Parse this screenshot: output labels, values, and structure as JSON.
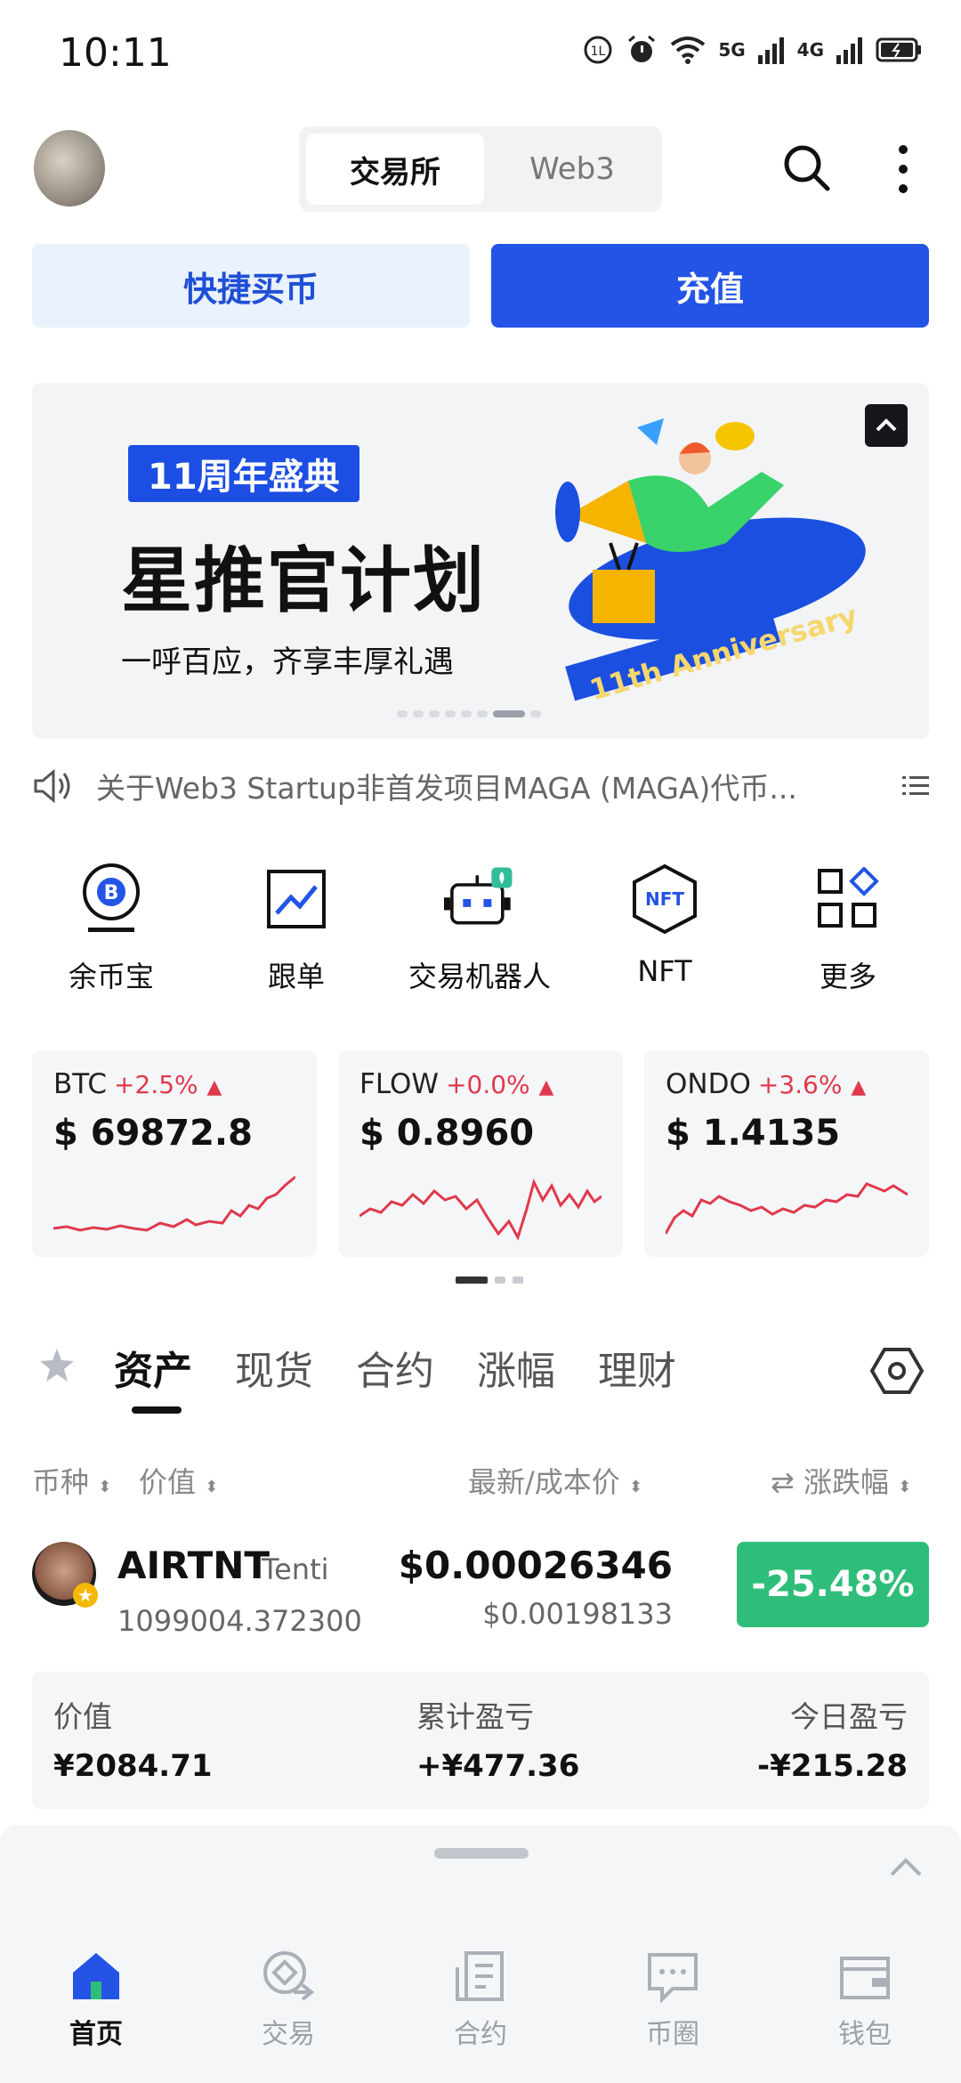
{
  "status_bar": {
    "time": "10:11",
    "signal_5g": "5G",
    "signal_4g": "4G"
  },
  "header": {
    "tabs": [
      {
        "label": "交易所",
        "active": true
      },
      {
        "label": "Web3",
        "active": false
      }
    ],
    "icons": [
      "search-icon",
      "more-vertical-icon"
    ]
  },
  "actions": {
    "quick_buy": "快捷买币",
    "deposit": "充值"
  },
  "banner": {
    "badge": "11周年盛典",
    "title": "星推官计划",
    "subtitle": "一呼百应，齐享丰厚礼遇",
    "art_text": "11th Anniversary",
    "slides_total": 8,
    "active_slide": 7
  },
  "notice": {
    "text": "关于Web3 Startup非首发项目MAGA (MAGA)代币..."
  },
  "shortcuts": [
    {
      "label": "余币宝",
      "icon": "bitcoin-coin-icon"
    },
    {
      "label": "跟单",
      "icon": "chart-line-icon"
    },
    {
      "label": "交易机器人",
      "icon": "robot-icon"
    },
    {
      "label": "NFT",
      "icon": "nft-hexagon-icon"
    },
    {
      "label": "更多",
      "icon": "grid-more-icon"
    }
  ],
  "market": {
    "cards": [
      {
        "symbol": "BTC",
        "change": "+2.5%",
        "price": "$ 69872.8"
      },
      {
        "symbol": "FLOW",
        "change": "+0.0%",
        "price": "$ 0.8960"
      },
      {
        "symbol": "ONDO",
        "change": "+3.6%",
        "price": "$ 1.4135"
      }
    ],
    "pages_total": 3,
    "active_page": 1,
    "color_up": "#e0394c"
  },
  "tabs": [
    {
      "label": "资产",
      "active": true
    },
    {
      "label": "现货",
      "active": false
    },
    {
      "label": "合约",
      "active": false
    },
    {
      "label": "涨幅",
      "active": false
    },
    {
      "label": "理财",
      "active": false
    }
  ],
  "list_header": {
    "coin": "币种",
    "value": "价值",
    "price": "最新/成本价",
    "change": "涨跌幅"
  },
  "asset": {
    "name": "AIRTNT",
    "tag": "Tenti",
    "quantity": "1099004.372300",
    "price": "$0.00026346",
    "cost": "$0.00198133",
    "change": "-25.48%",
    "change_color": "#2fbd7a"
  },
  "summary": {
    "value_label": "价值",
    "value": "¥2084.71",
    "total_pnl_label": "累计盈亏",
    "total_pnl": "+¥477.36",
    "today_pnl_label": "今日盈亏",
    "today_pnl": "-¥215.28"
  },
  "bottom_nav": [
    {
      "label": "首页",
      "active": true
    },
    {
      "label": "交易",
      "active": false
    },
    {
      "label": "合约",
      "active": false
    },
    {
      "label": "币圈",
      "active": false
    },
    {
      "label": "钱包",
      "active": false
    }
  ],
  "brand_blue": "#2354e6"
}
